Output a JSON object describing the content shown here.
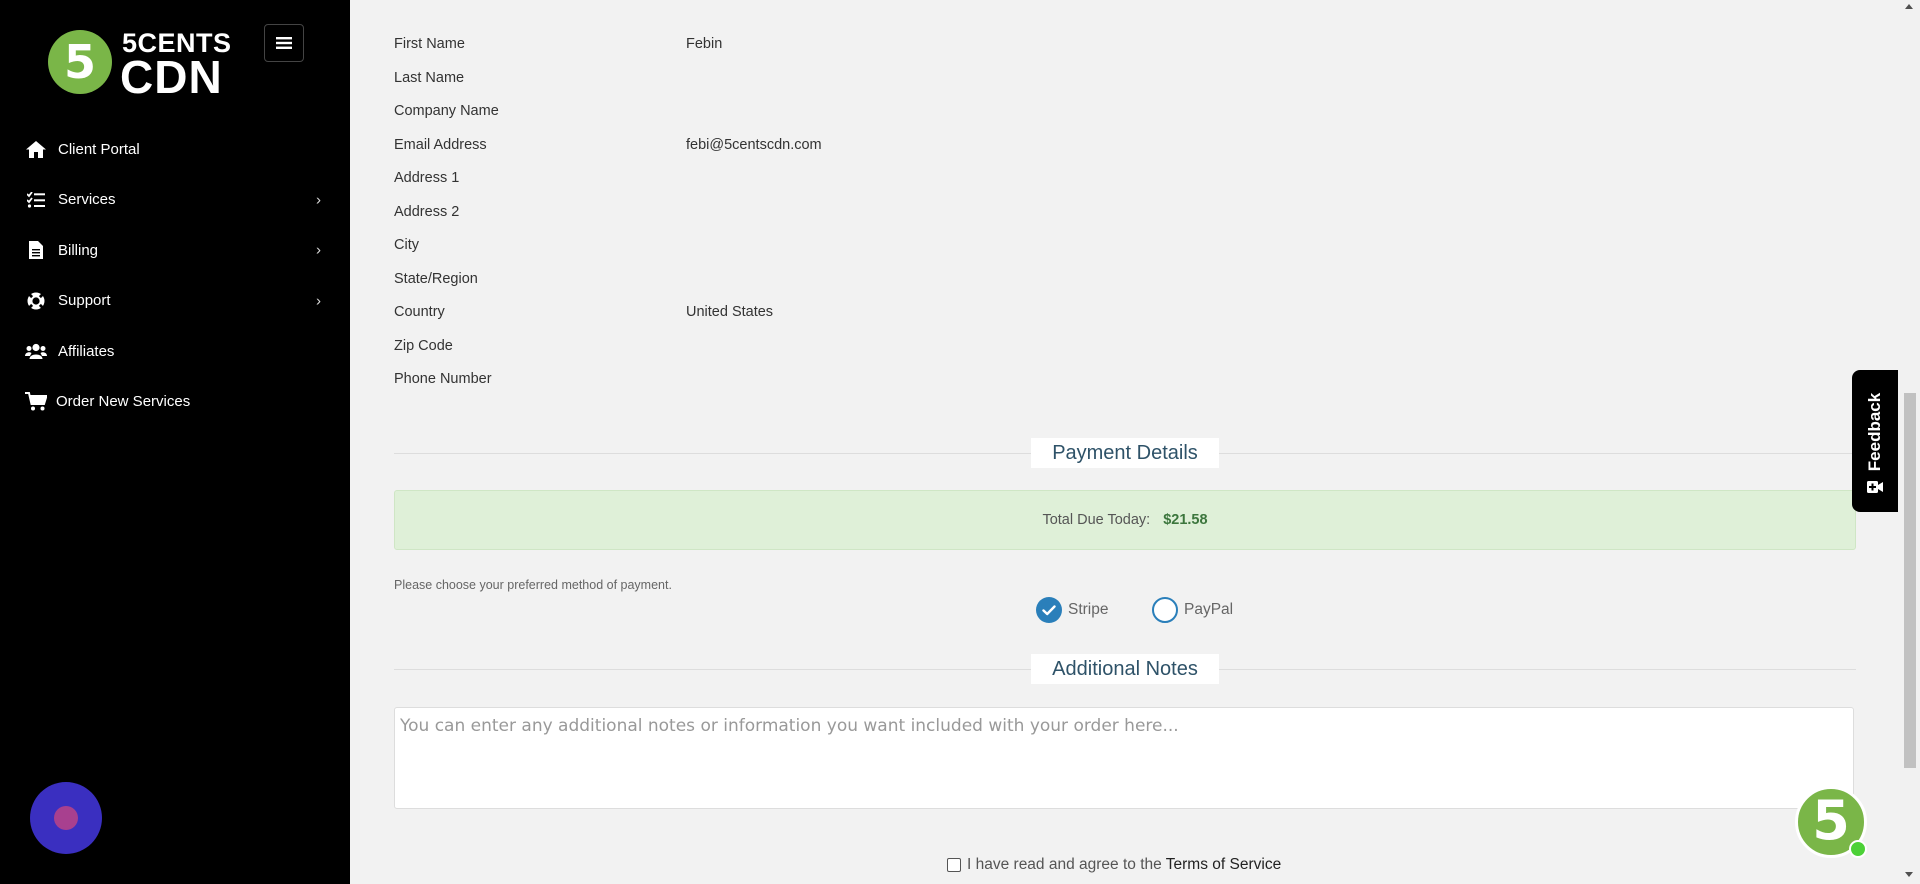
{
  "brand": {
    "logo_digit": "5",
    "logo_top": "5CENTS",
    "logo_bottom": "CDN",
    "color": "#7ab648"
  },
  "sidebar": {
    "items": [
      {
        "label": "Client Portal",
        "icon": "home-icon",
        "has_submenu": false
      },
      {
        "label": "Services",
        "icon": "list-icon",
        "has_submenu": true
      },
      {
        "label": "Billing",
        "icon": "file-icon",
        "has_submenu": true
      },
      {
        "label": "Support",
        "icon": "lifebuoy-icon",
        "has_submenu": true
      },
      {
        "label": "Affiliates",
        "icon": "users-icon",
        "has_submenu": false
      },
      {
        "label": "Order New Services",
        "icon": "cart-icon",
        "has_submenu": false
      }
    ]
  },
  "customer": {
    "fields": [
      {
        "label": "First Name",
        "value": "Febin"
      },
      {
        "label": "Last Name",
        "value": ""
      },
      {
        "label": "Company Name",
        "value": ""
      },
      {
        "label": "Email Address",
        "value": "febi@5centscdn.com"
      },
      {
        "label": "Address 1",
        "value": ""
      },
      {
        "label": "Address 2",
        "value": ""
      },
      {
        "label": "City",
        "value": ""
      },
      {
        "label": "State/Region",
        "value": ""
      },
      {
        "label": "Country",
        "value": "United States"
      },
      {
        "label": "Zip Code",
        "value": ""
      },
      {
        "label": "Phone Number",
        "value": ""
      }
    ]
  },
  "payment": {
    "title": "Payment Details",
    "total_label": "Total Due Today:",
    "total_value": "$21.58",
    "hint": "Please choose your preferred method of payment.",
    "methods": [
      {
        "label": "Stripe",
        "selected": true
      },
      {
        "label": "PayPal",
        "selected": false
      }
    ]
  },
  "notes": {
    "title": "Additional Notes",
    "placeholder": "You can enter any additional notes or information you want included with your order here..."
  },
  "tos": {
    "text": "I have read and agree to the",
    "link": "Terms of Service",
    "checked": false
  },
  "feedback": {
    "label": "Feedback"
  },
  "badge": {
    "digit": "5",
    "status": "online"
  }
}
